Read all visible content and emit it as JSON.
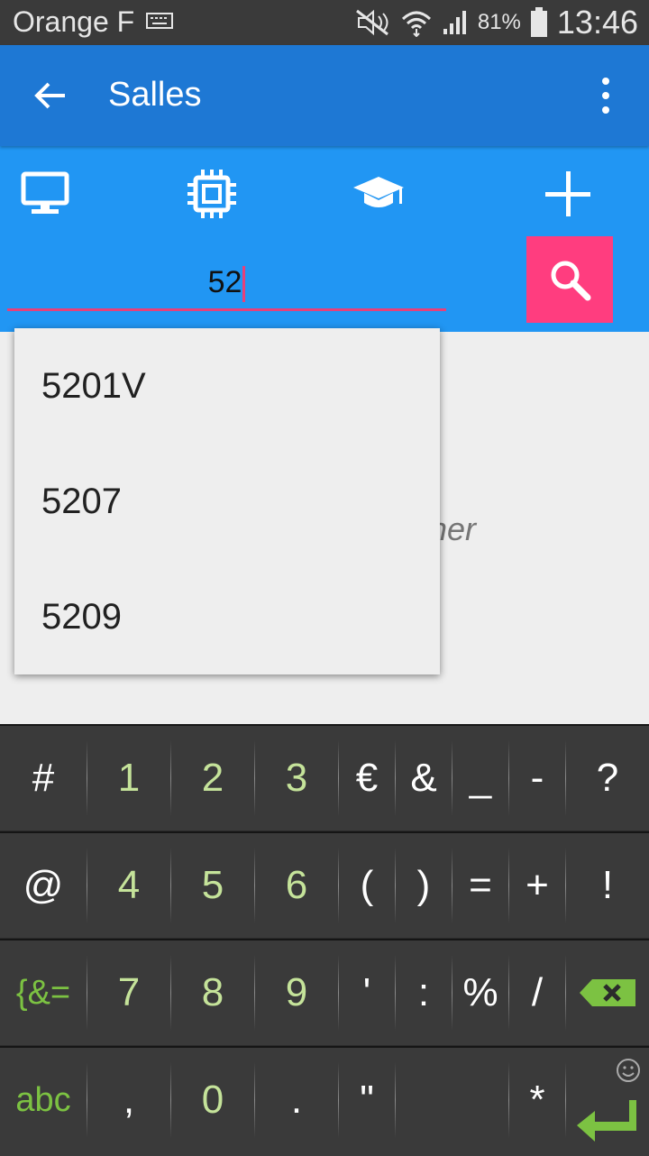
{
  "status": {
    "carrier": "Orange F",
    "battery": "81%",
    "time": "13:46"
  },
  "appbar": {
    "title": "Salles"
  },
  "toolbar": {
    "icons": [
      "computer-icon",
      "chip-icon",
      "graduation-cap-icon",
      "plus-icon"
    ]
  },
  "search": {
    "value": "52"
  },
  "main": {
    "hint_partial": "ficher"
  },
  "suggestions": [
    "5201V",
    "5207",
    "5209"
  ],
  "keyboard": {
    "rows": [
      [
        "#",
        "1",
        "2",
        "3",
        "€",
        "&",
        "_",
        "-",
        "?"
      ],
      [
        "@",
        "4",
        "5",
        "6",
        "(",
        ")",
        "=",
        "+",
        "!"
      ],
      [
        "{&=",
        "7",
        "8",
        "9",
        "'",
        ":",
        "%",
        "/",
        ""
      ],
      [
        "abc",
        ",",
        "0",
        ".",
        "\"",
        "",
        "*",
        ""
      ]
    ]
  },
  "colors": {
    "appbar": "#1e78d4",
    "toolbar": "#2196f3",
    "accent": "#ff3d7f",
    "kbd_green": "#7cc242"
  }
}
